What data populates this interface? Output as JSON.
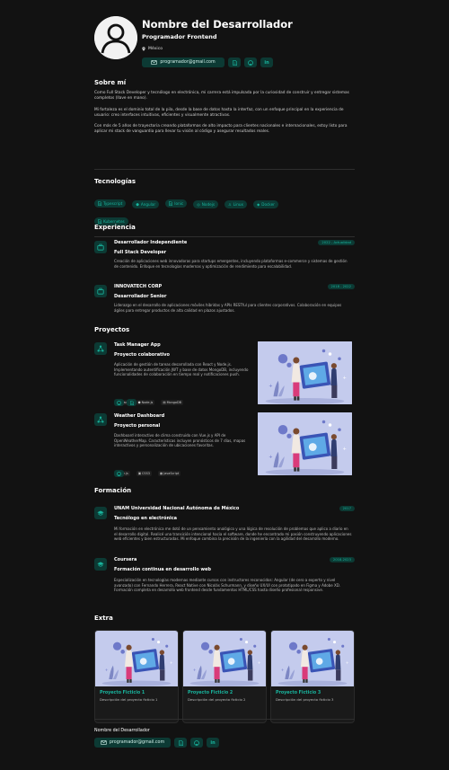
{
  "header": {
    "name": "Nombre del Desarrollador",
    "role": "Programador Frontend",
    "location": "México",
    "email": "programador@gmail.com"
  },
  "about": {
    "title": "Sobre mí",
    "p1": "Como Full Stack Developer y tecnólogo en electrónica, mi carrera está impulsada por la curiosidad de construir y entregar sistemas completos (llave en mano).",
    "p2": "Mi fortaleza es el dominio total de la pila, desde la base de datos hasta la interfaz, con un enfoque principal en la experiencia de usuario: creo interfaces intuitivas, eficientes y visualmente atractivas.",
    "p3": "Con más de 5 años de trayectoria creando plataformas de alto impacto para clientes nacionales e internacionales, estoy listo para aplicar mi stack de vanguardia para llevar tu visión al código y asegurar resultados reales."
  },
  "tech": {
    "title": "Tecnologías",
    "items": [
      "Typescript",
      "Angular",
      "Ionic",
      "Nodejs",
      "Linux",
      "Docker",
      "Kubernetes"
    ]
  },
  "experience": {
    "title": "Experiencia",
    "items": [
      {
        "company": "Desarrollador Independiente",
        "date": "2022 - Actualidad",
        "position": "Full Stack Developer",
        "desc": "Creación de aplicaciones web innovadoras para startups emergentes, incluyendo plataformas e-commerce y sistemas de gestión de contenido. Enfoque en tecnologías modernas y optimización de rendimiento para escalabilidad."
      },
      {
        "company": "INNOVATECH CORP",
        "date": "2018 - 2022",
        "position": "Desarrollador Senior",
        "desc": "Liderazgo en el desarrollo de aplicaciones móviles híbridas y APIs RESTful para clientes corporativos. Colaboración en equipos ágiles para entregar productos de alta calidad en plazos ajustados."
      }
    ]
  },
  "projects": {
    "title": "Proyectos",
    "items": [
      {
        "name": "Task Manager App",
        "type": "Proyecto colaborativo",
        "desc": "Aplicación de gestión de tareas desarrollada con React y Node.js. Implementando autentificación JWT y base de datos MongoDB, incluyendo funcionalidades de colaboración en tiempo real y notificaciones push.",
        "tags": [
          "React",
          "Node.js",
          "MongoDB"
        ]
      },
      {
        "name": "Weather Dashboard",
        "type": "Proyecto personal",
        "desc": "Dashboard interactivo de clima construido con Vue.js y API de OpenWeatherMap. Características incluyen pronósticos de 7 días, mapas interactivos y personalización de ubicaciones favoritas.",
        "tags": [
          "Vue.js",
          "CSS3",
          "JavaScript"
        ]
      }
    ]
  },
  "education": {
    "title": "Formación",
    "items": [
      {
        "school": "UNAM Universidad Nacional Autónoma de México",
        "date": "2017",
        "degree": "Tecnólogo en electrónica",
        "desc": "Mi formación en electrónica me dotó de un pensamiento analógico y una lógica de resolución de problemas que aplico a diario en el desarrollo digital. Realicé una transición intencional hacia el software, donde he encontrado mi pasión construyendo aplicaciones web eficientes y bien estructuradas. Mi enfoque combina la precisión de la ingeniería con la agilidad del desarrollo moderno."
      },
      {
        "school": "Coursera",
        "date": "2018-2023",
        "degree": "Formación continua en desarrollo web",
        "desc": "Especialización en tecnologías modernas mediante cursos con instructores reconocidos: Angular (de cero a experto y nivel avanzado) con Fernando Herrera, React Native con Nicolás Schurmann, y diseño UX/UI con prototipado en Figma y Adobe XD. Formación completa en desarrollo web frontend desde fundamentos HTML/CSS hasta diseño profesional responsive."
      }
    ]
  },
  "extra": {
    "title": "Extra",
    "items": [
      {
        "title": "Proyecto Ficticio 1",
        "desc": "Descripción del proyecto ficticio 1"
      },
      {
        "title": "Proyecto Ficticio 2",
        "desc": "Descripción del proyecto ficticio 2"
      },
      {
        "title": "Proyecto Ficticio 3",
        "desc": "Descripción del proyecto ficticio 3"
      }
    ]
  },
  "footer": {
    "name": "Nombre del Desarrollador",
    "email": "programador@gmail.com"
  },
  "colors": {
    "accent": "#19b59e",
    "chip_bg": "#0c3a34",
    "background": "#121212"
  },
  "icons": {
    "email": "mail-icon",
    "cv": "document-icon",
    "github": "github-icon",
    "linkedin": "linkedin-icon"
  }
}
